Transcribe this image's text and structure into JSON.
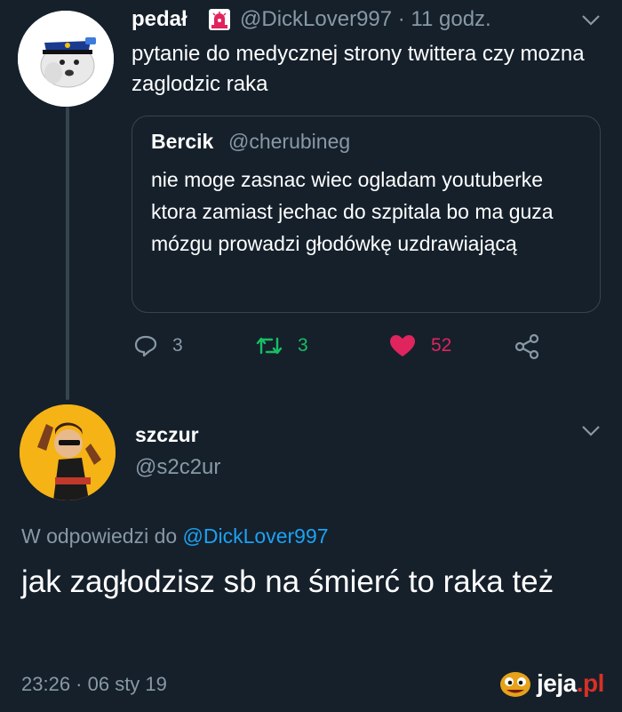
{
  "thread": {
    "parent": {
      "name": "pedał",
      "handle_time": "@DickLover997 · 11 godz.",
      "text": "pytanie do medycznej strony twittera czy mozna zaglodzic raka",
      "quote": {
        "name": "Bercik",
        "handle": "@cherubineg",
        "text": "nie moge zasnac wiec ogladam youtuberke ktora zamiast jechac do szpitala bo ma guza mózgu prowadzi głodówkę uzdrawiającą"
      },
      "actions": {
        "replies": "3",
        "retweets": "3",
        "likes": "52"
      }
    },
    "reply": {
      "name": "szczur",
      "handle": "@s2c2ur",
      "reply_prefix": "W odpowiedzi do",
      "reply_target": "@DickLover997",
      "text": "jak zagłodzisz sb na śmierć to raka też",
      "timestamp": "23:26 · 06 sty 19"
    }
  },
  "watermark": {
    "brand": "jeja",
    "tld": ".pl"
  },
  "colors": {
    "background": "#15202b",
    "muted": "#8899a6",
    "link": "#1da1f2",
    "retweet": "#17bf63",
    "like": "#e0245e"
  },
  "icons": [
    "police-siren-icon",
    "chevron-down-icon",
    "reply-icon",
    "retweet-icon",
    "like-icon",
    "share-icon"
  ]
}
